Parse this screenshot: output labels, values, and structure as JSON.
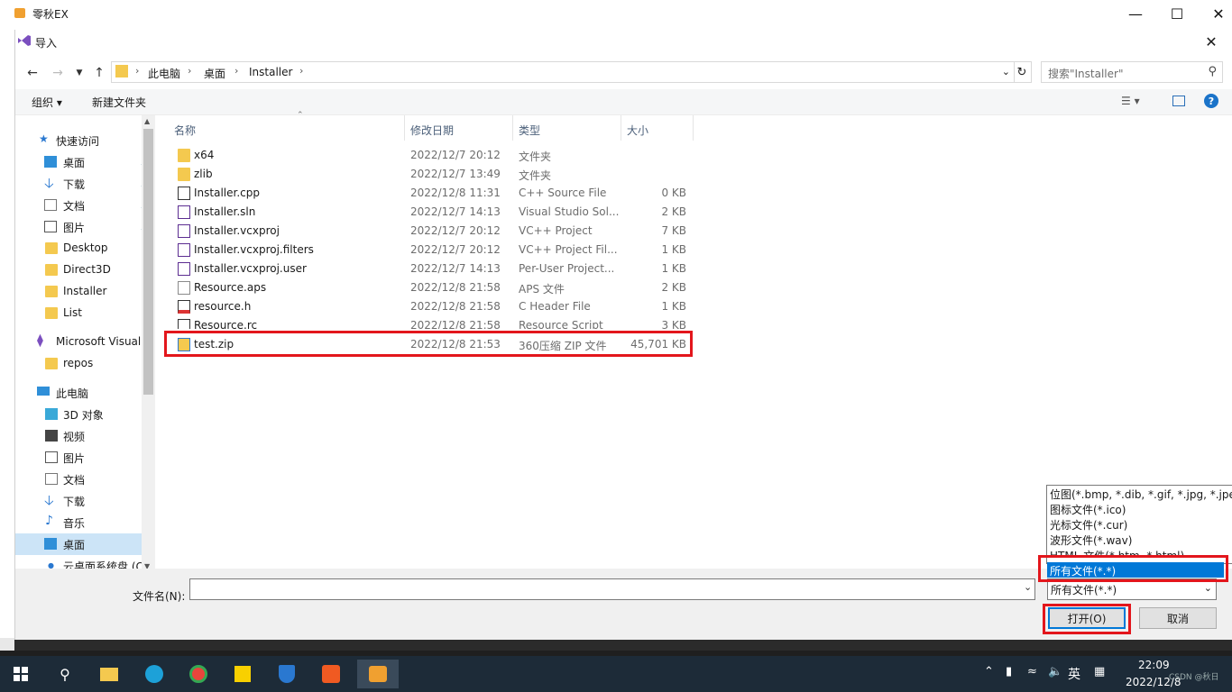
{
  "app": {
    "title": "零秋EX"
  },
  "dialog": {
    "title": "导入"
  },
  "breadcrumb": [
    "此电脑",
    "桌面",
    "Installer"
  ],
  "search": {
    "placeholder": "搜索\"Installer\""
  },
  "toolbar": {
    "organize": "组织",
    "new_folder": "新建文件夹"
  },
  "nav": {
    "quick_access": "快速访问",
    "items": [
      {
        "label": "桌面",
        "pinned": true
      },
      {
        "label": "下载",
        "pinned": true
      },
      {
        "label": "文档",
        "pinned": true
      },
      {
        "label": "图片",
        "pinned": true
      },
      {
        "label": "Desktop"
      },
      {
        "label": "Direct3D"
      },
      {
        "label": "Installer"
      },
      {
        "label": "List"
      }
    ],
    "vs_item": "Microsoft Visual",
    "repos": "repos",
    "this_pc": "此电脑",
    "pc_items": [
      "3D 对象",
      "视频",
      "图片",
      "文档",
      "下载",
      "音乐",
      "桌面",
      "云桌面系统盘 (C"
    ]
  },
  "columns": {
    "name": "名称",
    "date": "修改日期",
    "type": "类型",
    "size": "大小"
  },
  "files": [
    {
      "name": "x64",
      "date": "2022/12/7 20:12",
      "type": "文件夹",
      "size": "",
      "icon": "folder-icon"
    },
    {
      "name": "zlib",
      "date": "2022/12/7 13:49",
      "type": "文件夹",
      "size": "",
      "icon": "folder-icon"
    },
    {
      "name": "Installer.cpp",
      "date": "2022/12/8 11:31",
      "type": "C++ Source File",
      "size": "0 KB",
      "icon": "cpp-file-icon"
    },
    {
      "name": "Installer.sln",
      "date": "2022/12/7 14:13",
      "type": "Visual Studio Sol...",
      "size": "2 KB",
      "icon": "sln-file-icon"
    },
    {
      "name": "Installer.vcxproj",
      "date": "2022/12/7 20:12",
      "type": "VC++ Project",
      "size": "7 KB",
      "icon": "vcxproj-file-icon"
    },
    {
      "name": "Installer.vcxproj.filters",
      "date": "2022/12/7 20:12",
      "type": "VC++ Project Fil...",
      "size": "1 KB",
      "icon": "filters-file-icon"
    },
    {
      "name": "Installer.vcxproj.user",
      "date": "2022/12/7 14:13",
      "type": "Per-User Project...",
      "size": "1 KB",
      "icon": "user-file-icon"
    },
    {
      "name": "Resource.aps",
      "date": "2022/12/8 21:58",
      "type": "APS 文件",
      "size": "2 KB",
      "icon": "aps-file-icon"
    },
    {
      "name": "resource.h",
      "date": "2022/12/8 21:58",
      "type": "C Header File",
      "size": "1 KB",
      "icon": "header-file-icon"
    },
    {
      "name": "Resource.rc",
      "date": "2022/12/8 21:58",
      "type": "Resource Script",
      "size": "3 KB",
      "icon": "rc-file-icon"
    },
    {
      "name": "test.zip",
      "date": "2022/12/8 21:53",
      "type": "360压缩 ZIP 文件",
      "size": "45,701 KB",
      "icon": "zip-file-icon"
    }
  ],
  "filename": {
    "label": "文件名(N):",
    "value": ""
  },
  "filetype": {
    "selected": "所有文件(*.*)",
    "options": [
      "位图(*.bmp, *.dib, *.gif, *.jpg, *.jpe,",
      "图标文件(*.ico)",
      "光标文件(*.cur)",
      "波形文件(*.wav)",
      "HTML 文件(*.htm, *.html)",
      "所有文件(*.*)"
    ]
  },
  "buttons": {
    "open": "打开(O)",
    "cancel": "取消"
  },
  "taskbar": {
    "time": "22:09",
    "date": "2022/12/8",
    "ime": "英",
    "watermark": "CSDN @秋日"
  },
  "colors": {
    "highlight": "#e3161c",
    "selection": "#0078d7",
    "taskbar": "#1d2b38"
  }
}
